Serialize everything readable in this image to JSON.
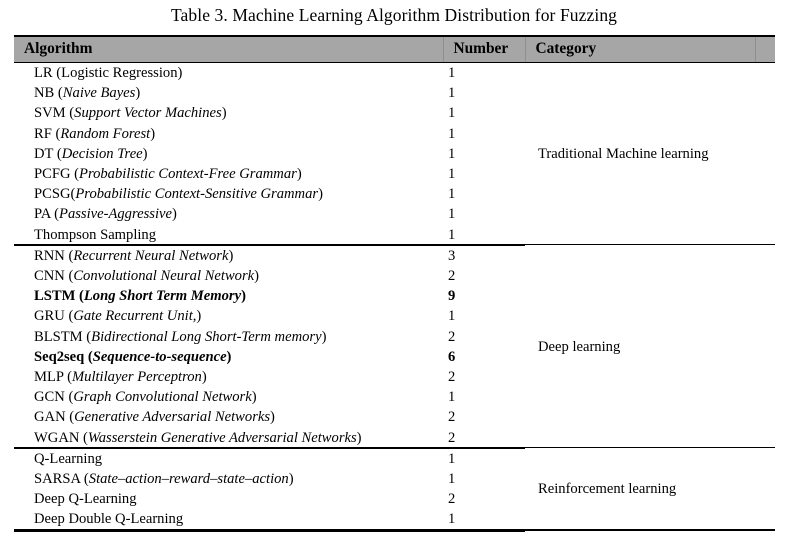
{
  "caption": "Table 3. Machine Learning Algorithm Distribution for Fuzzing",
  "columns": {
    "algorithm": "Algorithm",
    "number": "Number",
    "category": "Category"
  },
  "colors": {
    "header_fill": "#a6a6a6",
    "rule": "#000000",
    "text": "#000000",
    "page_background": "#ffffff"
  },
  "groups": [
    {
      "category": "Traditional Machine learning",
      "rows": [
        {
          "abbr": "LR",
          "expansion": "Logistic Regression",
          "expansion_italic": false,
          "bold": false,
          "number": "1"
        },
        {
          "abbr": "NB",
          "expansion": "Naive Bayes",
          "expansion_italic": true,
          "bold": false,
          "number": "1"
        },
        {
          "abbr": "SVM",
          "expansion": "Support Vector Machines",
          "expansion_italic": true,
          "bold": false,
          "number": "1"
        },
        {
          "abbr": "RF",
          "expansion": "Random Forest",
          "expansion_italic": true,
          "bold": false,
          "number": "1"
        },
        {
          "abbr": "DT",
          "expansion": "Decision Tree",
          "expansion_italic": true,
          "bold": false,
          "number": "1"
        },
        {
          "abbr": "PCFG",
          "expansion": "Probabilistic Context-Free Grammar",
          "expansion_italic": true,
          "bold": false,
          "number": "1"
        },
        {
          "abbr": "PCSG",
          "expansion": "Probabilistic Context-Sensitive Grammar",
          "expansion_italic": true,
          "bold": false,
          "no_space_before_paren": true,
          "number": "1"
        },
        {
          "abbr": "PA",
          "expansion": "Passive-Aggressive",
          "expansion_italic": true,
          "bold": false,
          "number": "1"
        },
        {
          "abbr": "Thompson Sampling",
          "expansion": null,
          "expansion_italic": false,
          "bold": false,
          "number": "1"
        }
      ]
    },
    {
      "category": "Deep learning",
      "rows": [
        {
          "abbr": "RNN",
          "expansion": "Recurrent Neural Network",
          "expansion_italic": true,
          "bold": false,
          "number": "3"
        },
        {
          "abbr": "CNN",
          "expansion": "Convolutional Neural Network",
          "expansion_italic": true,
          "bold": false,
          "number": "2"
        },
        {
          "abbr": "LSTM",
          "expansion": "Long Short Term Memory",
          "expansion_italic": true,
          "bold": true,
          "number": "9"
        },
        {
          "abbr": "GRU",
          "expansion": "Gate Recurrent Unit,",
          "expansion_italic": true,
          "bold": false,
          "number": "1"
        },
        {
          "abbr": "BLSTM",
          "expansion": "Bidirectional Long Short-Term memory",
          "expansion_italic": true,
          "bold": false,
          "number": "2"
        },
        {
          "abbr": "Seq2seq",
          "expansion": "Sequence-to-sequence",
          "expansion_italic": true,
          "bold": true,
          "number": "6"
        },
        {
          "abbr": "MLP",
          "expansion": "Multilayer Perceptron",
          "expansion_italic": true,
          "bold": false,
          "number": "2"
        },
        {
          "abbr": "GCN",
          "expansion": "Graph Convolutional Network",
          "expansion_italic": true,
          "bold": false,
          "number": "1"
        },
        {
          "abbr": "GAN",
          "expansion": "Generative Adversarial Networks",
          "expansion_italic": true,
          "bold": false,
          "number": "2"
        },
        {
          "abbr": "WGAN",
          "expansion": "Wasserstein Generative Adversarial Networks",
          "expansion_italic": true,
          "bold": false,
          "number": "2"
        }
      ]
    },
    {
      "category": "Reinforcement learning",
      "rows": [
        {
          "abbr": "Q-Learning",
          "expansion": null,
          "expansion_italic": false,
          "bold": false,
          "number": "1"
        },
        {
          "abbr": "SARSA",
          "expansion": "State–action–reward–state–action",
          "expansion_italic": true,
          "bold": false,
          "number": "1"
        },
        {
          "abbr": "Deep Q-Learning",
          "expansion": null,
          "expansion_italic": false,
          "bold": false,
          "number": "2"
        },
        {
          "abbr": "Deep Double Q-Learning",
          "expansion": null,
          "expansion_italic": false,
          "bold": false,
          "number": "1"
        }
      ]
    }
  ]
}
